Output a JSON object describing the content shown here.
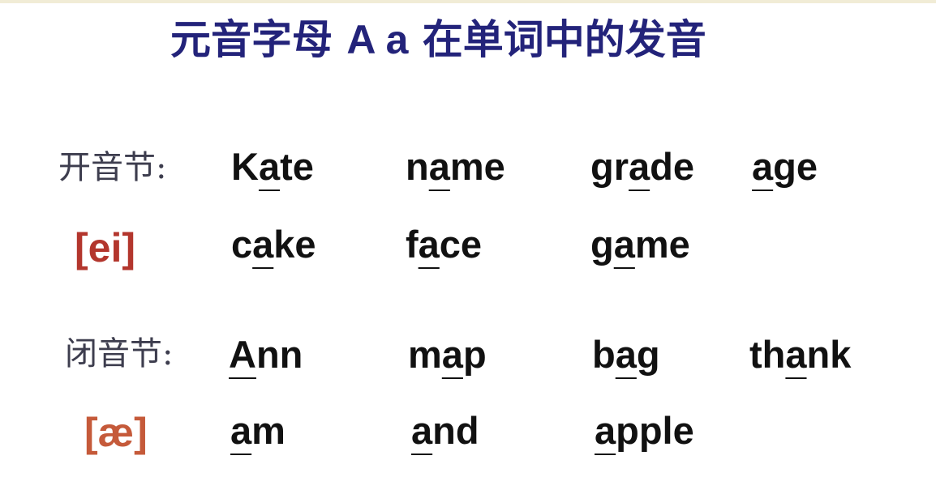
{
  "title": {
    "pre": "元音字母 ",
    "letters": "A a",
    "post": " 在单词中的发音"
  },
  "colors": {
    "title": "#23237a",
    "label": "#3d3d4e",
    "phonetic_ei": "#b3362d",
    "phonetic_ae": "#c55a3a",
    "word": "#111111"
  },
  "open_syllable": {
    "label": "开音节:",
    "phonetic": "[ei]",
    "row1": [
      {
        "pre": "K",
        "mark": "a",
        "post": "te"
      },
      {
        "pre": "n",
        "mark": "a",
        "post": "me"
      },
      {
        "pre": "gr",
        "mark": "a",
        "post": "de"
      },
      {
        "pre": "",
        "mark": "a",
        "post": "ge"
      }
    ],
    "row2": [
      {
        "pre": "c",
        "mark": "a",
        "post": "ke"
      },
      {
        "pre": "f",
        "mark": "a",
        "post": "ce"
      },
      {
        "pre": "g",
        "mark": "a",
        "post": "me"
      }
    ]
  },
  "closed_syllable": {
    "label": "闭音节:",
    "phonetic": "[æ]",
    "row1": [
      {
        "pre": "",
        "mark": "A",
        "post": "nn"
      },
      {
        "pre": "m",
        "mark": "a",
        "post": "p"
      },
      {
        "pre": "b",
        "mark": "a",
        "post": "g"
      },
      {
        "pre": "th",
        "mark": "a",
        "post": "nk"
      }
    ],
    "row2": [
      {
        "pre": "",
        "mark": "a",
        "post": "m"
      },
      {
        "pre": "",
        "mark": "a",
        "post": "nd"
      },
      {
        "pre": "",
        "mark": "a",
        "post": "pple"
      }
    ]
  }
}
